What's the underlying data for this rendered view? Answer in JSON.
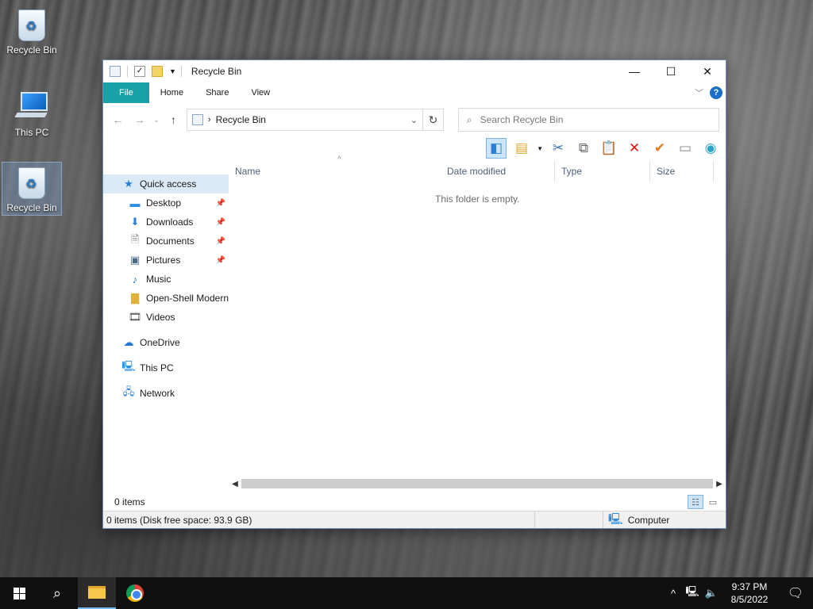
{
  "desktop": {
    "icons": [
      {
        "label": "Recycle Bin"
      },
      {
        "label": "This PC"
      },
      {
        "label": "Recycle Bin"
      }
    ]
  },
  "window": {
    "title": "Recycle Bin",
    "tabs": [
      "File",
      "Home",
      "Share",
      "View"
    ],
    "address": {
      "path": "Recycle Bin"
    },
    "search": {
      "placeholder": "Search Recycle Bin"
    },
    "nav": {
      "quick_access": "Quick access",
      "pinned": [
        "Desktop",
        "Downloads",
        "Documents",
        "Pictures"
      ],
      "unpinned": [
        "Music",
        "Open-Shell Modern",
        "Videos"
      ],
      "onedrive": "OneDrive",
      "this_pc": "This PC",
      "network": "Network"
    },
    "columns": [
      "Name",
      "Date modified",
      "Type",
      "Size"
    ],
    "empty_message": "This folder is empty.",
    "item_count": "0 items",
    "status": {
      "left": "0 items (Disk free space: 93.9 GB)",
      "right": "Computer"
    }
  },
  "taskbar": {
    "time": "9:37 PM",
    "date": "8/5/2022"
  },
  "colors": {
    "file_tab": "#19a1a8",
    "selection": "#dbeaf7",
    "taskbar": "#101010"
  }
}
